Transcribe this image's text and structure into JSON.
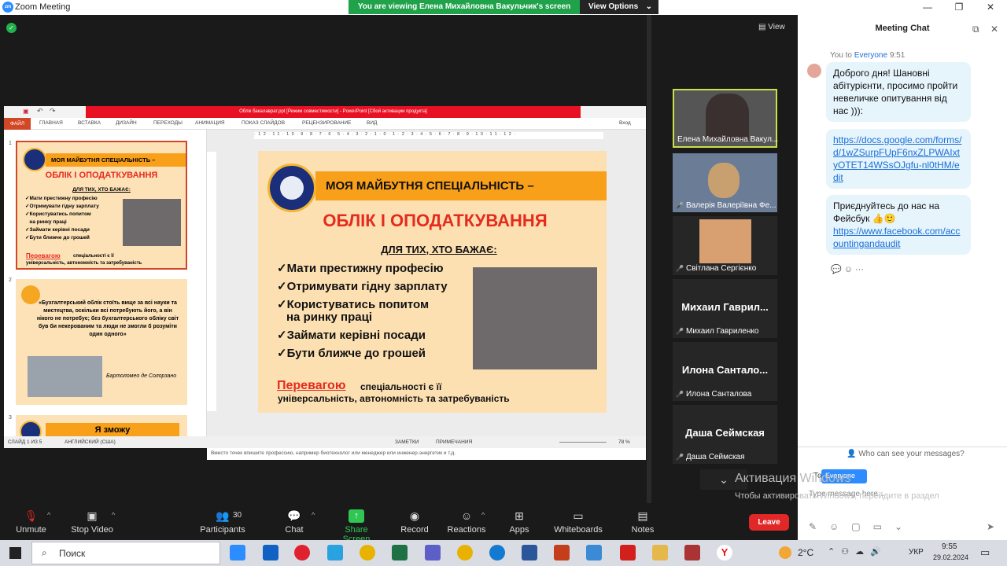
{
  "window": {
    "title": "Zoom Meeting"
  },
  "banner": {
    "text": "You are viewing Елена Михайловна Вакульчик's screen",
    "view_options": "View Options"
  },
  "stage": {
    "view_label": "View"
  },
  "ppt": {
    "title": "Облік бакалаврат.ppt [Режим совместимости] - PowerPoint [Сбой активации продукта]",
    "tabs": [
      "ФАЙЛ",
      "ГЛАВНАЯ",
      "ВСТАВКА",
      "ДИЗАЙН",
      "ПЕРЕХОДЫ",
      "АНИМАЦИЯ",
      "ПОКАЗ СЛАЙДОВ",
      "РЕЦЕНЗИРОВАНИЕ",
      "ВИД"
    ],
    "signin": "Вход",
    "ruler": "·12·11·10·9·8·7·6·5·4·3·2·1·0·1·2·3·4·5·6·7·8·9·10·11·12·",
    "slide": {
      "band": "МОЯ МАЙБУТНЯ СПЕЦІАЛЬНІСТЬ –",
      "heading": "ОБЛІК І ОПОДАТКУВАННЯ",
      "sub": "ДЛЯ ТИХ, ХТО БАЖАЄ:",
      "bullets": [
        "✓Мати престижну професію",
        "✓Отримувати гідну зарплату",
        "✓Користуватись попитом",
        "на ринку праці",
        "✓Займати керівні посади",
        "✓Бути ближче до грошей"
      ],
      "adv_word": "Перевагою",
      "adv_rest": "спеціальності є її",
      "adv_line2": "універсальність, автономність та затребуваність"
    },
    "thumb1": {
      "band": "МОЯ МАЙБУТНЯ СПЕЦІАЛЬНІСТЬ –",
      "heading": "ОБЛІК І ОПОДАТКУВАННЯ",
      "sub": "ДЛЯ ТИХ, ХТО БАЖАЄ:",
      "bullets": "✓Мати престижну професію\n✓Отримувати гідну зарплату\n✓Користуватись попитом\n   на ринку праці\n✓Займати керівні посади\n✓Бути ближче до грошей",
      "adv": "Перевагою",
      "adv_rest": "спеціальності є її\nуніверсальність, автономність та затребуваність"
    },
    "thumb2": {
      "quote": "«Бухгалтерський облік стоїть вище за всі науки та мистецтва, оскільки всі потребують його, а він нікого не потребує; без бухгалтерського обліку світ був би некерованим та люди не змогли б розуміти один одного»",
      "author": "Бартоломео де Солорзано"
    },
    "thumb3": {
      "title": "Я зможу"
    },
    "notes": "Вместо точек впишите профессию, например биотехнолог или менеджер или инженер-энергетик и т.д.",
    "status": {
      "slide": "СЛАЙД 1 ИЗ 5",
      "lang": "АНГЛИЙСКИЙ (США)",
      "notes": "ЗАМЕТКИ",
      "comments": "ПРИМЕЧАНИЯ",
      "zoom": "78 %"
    }
  },
  "participants": [
    {
      "name": "Елена Михайловна Вакул...",
      "big": "",
      "video": true
    },
    {
      "name": "Валерія Валеріївна Фе...",
      "big": "",
      "video": true
    },
    {
      "name": "Світлана Сергієнко",
      "big": "",
      "video": true
    },
    {
      "name": "Михаил Гавриленко",
      "big": "Михаил  Гаврил...",
      "video": false
    },
    {
      "name": "Илона Санталова",
      "big": "Илона  Сантало...",
      "video": false
    },
    {
      "name": "Даша Сеймская",
      "big": "Даша Сеймская",
      "video": false
    }
  ],
  "chat": {
    "header": "Meeting Chat",
    "from_prefix": "You to",
    "to": "Everyone",
    "time": "9:51",
    "msg1": "Доброго дня! Шановні абітурієнти, просимо пройти невеличке опитування від нас ))):",
    "msg2": "https://docs.google.com/forms/d/1wZSurpFUpF6nxZLPWAIxtyOTET14WSsOJgfu-nl0tHM/edit",
    "msg3a": "Приєднуйтесь до нас на Фейсбук 👍🙂",
    "msg3b": "https://www.facebook.com/accountingandaudit",
    "who_can_see": "Who can see your messages?",
    "to_label": "To:",
    "to_value": "Everyone",
    "placeholder": "Type message here...",
    "activation_title": "Активация Windows",
    "activation_text": "Чтобы активировать Windows, перейдите в раздел \"Параметры\"."
  },
  "toolbar": {
    "unmute": "Unmute",
    "stop_video": "Stop Video",
    "participants": "Participants",
    "participants_count": "30",
    "chat": "Chat",
    "share": "Share Screen",
    "record": "Record",
    "reactions": "Reactions",
    "apps": "Apps",
    "whiteboards": "Whiteboards",
    "notes": "Notes",
    "leave": "Leave"
  },
  "taskbar": {
    "search": "Поиск",
    "temp": "2°C",
    "lang": "УКР",
    "time": "9:55",
    "date": "29.02.2024"
  }
}
